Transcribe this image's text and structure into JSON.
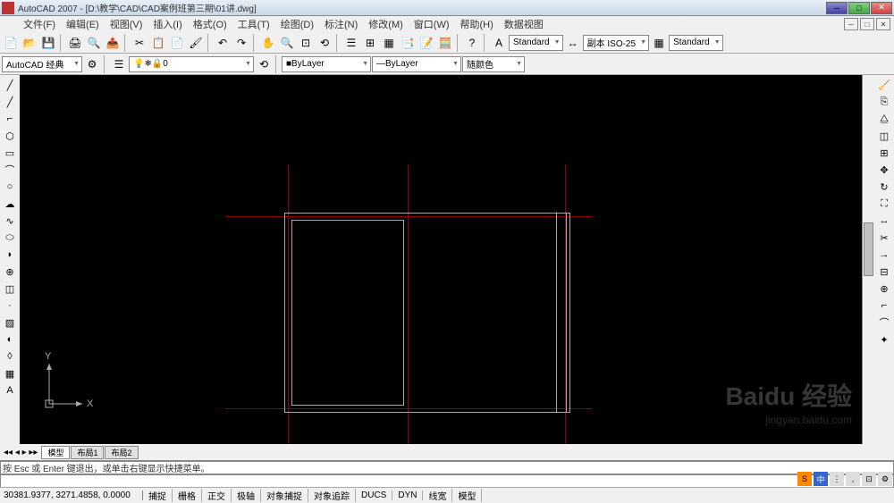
{
  "window": {
    "title": "AutoCAD 2007 - [D:\\教学\\CAD\\CAD案例班第三期\\01讲.dwg]"
  },
  "menu": {
    "file": "文件(F)",
    "edit": "编辑(E)",
    "view": "视图(V)",
    "insert": "插入(I)",
    "format": "格式(O)",
    "tools": "工具(T)",
    "draw": "绘图(D)",
    "dimension": "标注(N)",
    "modify": "修改(M)",
    "window": "窗口(W)",
    "help": "帮助(H)",
    "data_view": "数据视图"
  },
  "toolbars": {
    "workspace_label": "AutoCAD 经典",
    "style1": "Standard",
    "style2": "副本 ISO-25",
    "style3": "Standard",
    "layer_color": "ByLayer",
    "layer_ltype": "ByLayer",
    "color_control": "随颜色",
    "layer_current": "0"
  },
  "tabs": {
    "model": "模型",
    "layout1": "布局1",
    "layout2": "布局2"
  },
  "command": {
    "prompt": "按 Esc 或 Enter 键退出，或单击右键显示快捷菜单。"
  },
  "status": {
    "coords": "30381.9377, 3271.4858, 0.0000",
    "snap": "捕捉",
    "grid": "栅格",
    "ortho": "正交",
    "polar": "极轴",
    "osnap": "对象捕捉",
    "otrack": "对象追踪",
    "ducs": "DUCS",
    "dyn": "DYN",
    "lwt": "线宽",
    "model": "模型"
  },
  "ucs": {
    "x": "X",
    "y": "Y"
  },
  "watermark": {
    "main": "Baidu 经验",
    "sub": "jingyan.baidu.com"
  }
}
